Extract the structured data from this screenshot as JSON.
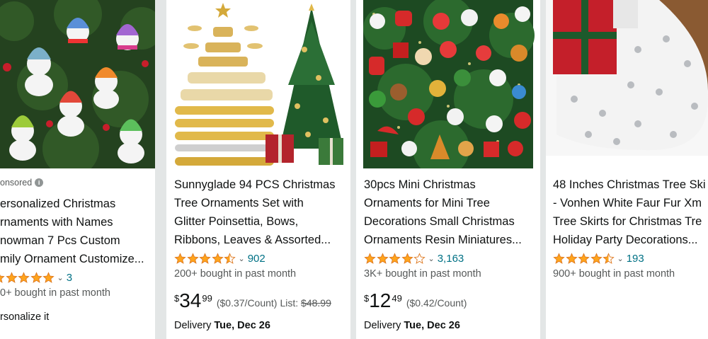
{
  "products": [
    {
      "sponsored_label": "onsored",
      "title_lines": [
        "ersonalized Christmas",
        "rnaments with Names",
        "nowman 7 Pcs Custom",
        "mily Ornament Customize..."
      ],
      "rating": 5.0,
      "rating_count": "3",
      "bought": "0+ bought in past month",
      "action_text": "rsonalize it"
    },
    {
      "title_lines": [
        "Sunnyglade 94 PCS Christmas",
        "Tree Ornaments Set with",
        "Glitter Poinsettia, Bows,",
        "Ribbons, Leaves & Assorted..."
      ],
      "rating": 4.5,
      "rating_count": "902",
      "bought": "200+ bought in past month",
      "price": {
        "currency": "$",
        "whole": "34",
        "fraction": "99",
        "unit_price": "($0.37/Count)",
        "list_label": "List:",
        "list_price": "$48.99"
      },
      "delivery": {
        "label": "Delivery",
        "date": "Tue, Dec 26"
      }
    },
    {
      "title_lines": [
        "30pcs Mini Christmas",
        "Ornaments for Mini Tree",
        "Decorations Small Christmas",
        "Ornaments Resin Miniatures..."
      ],
      "rating": 4.0,
      "rating_count": "3,163",
      "bought": "3K+ bought in past month",
      "price": {
        "currency": "$",
        "whole": "12",
        "fraction": "49",
        "unit_price": "($0.42/Count)"
      },
      "delivery": {
        "label": "Delivery",
        "date": "Tue, Dec 26"
      }
    },
    {
      "title_lines": [
        "48 Inches Christmas Tree Ski",
        "- Vonhen White Faur Fur Xm",
        "Tree Skirts for Christmas Tre",
        "Holiday Party Decorations..."
      ],
      "rating": 4.5,
      "rating_count": "193",
      "bought": "900+ bought in past month"
    }
  ],
  "colors": {
    "star": "#ffa41c",
    "link": "#007185",
    "muted": "#565959",
    "page_bg": "#e3e6e6"
  },
  "icons": {
    "star": "star-icon",
    "chevron": "chevron-down-icon",
    "info": "info-icon"
  }
}
